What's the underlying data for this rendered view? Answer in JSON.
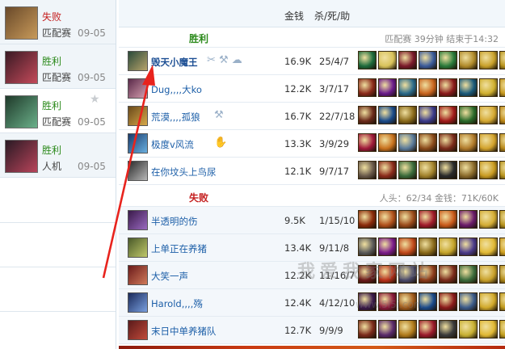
{
  "left_matches": [
    {
      "result": "失败",
      "type": "lose",
      "mode": "匹配赛",
      "date": "09-05",
      "portrait": [
        "#6a4a2a",
        "#c89a5a"
      ]
    },
    {
      "result": "胜利",
      "type": "win",
      "mode": "匹配赛",
      "date": "09-05",
      "portrait": [
        "#3a1a24",
        "#c44a5a"
      ]
    },
    {
      "result": "胜利",
      "type": "win",
      "mode": "匹配赛",
      "date": "09-05",
      "portrait": [
        "#1f3a2a",
        "#6bb08a"
      ],
      "starred": true,
      "active": true
    },
    {
      "result": "胜利",
      "type": "win",
      "mode": "人机",
      "date": "09-05",
      "portrait": [
        "#2a1a24",
        "#b8445a"
      ]
    }
  ],
  "header": {
    "gold_label": "金钱",
    "kda_label": "杀/死/助"
  },
  "team_win": {
    "title": "胜利",
    "meta": "匹配赛 39分钟 结束于14:32",
    "players": [
      {
        "name": "毁天小魔王",
        "me": true,
        "tags": "✂ ⚒ ☁",
        "gold": "16.9K",
        "kda": "25/4/7",
        "champ": [
          "#2a4a3a",
          "#b7a36a"
        ]
      },
      {
        "name": "Dug,,,,大ko",
        "tags": "",
        "gold": "12.2K",
        "kda": "3/7/17",
        "champ": [
          "#5a2a4a",
          "#d7a0b0"
        ]
      },
      {
        "name": "荒漠,,,,孤狼",
        "tags": "⚒",
        "gold": "16.7K",
        "kda": "22/7/18",
        "champ": [
          "#6a4a1a",
          "#d6a84a"
        ]
      },
      {
        "name": "极度v风流",
        "tags": "✋",
        "gold": "13.3K",
        "kda": "3/9/29",
        "champ": [
          "#1a3a6a",
          "#6ab0e0"
        ]
      },
      {
        "name": "在你坟头上鸟尿",
        "tags": "",
        "gold": "12.1K",
        "kda": "9/7/17",
        "champ": [
          "#2a2a2a",
          "#b8b8b8"
        ]
      }
    ]
  },
  "team_lose": {
    "title": "失败",
    "meta": "人头：62/34 金钱：71K/60K",
    "players": [
      {
        "name": "半透明的伤",
        "gold": "9.5K",
        "kda": "1/15/10",
        "champ": [
          "#3a1a4a",
          "#9a6ac0"
        ]
      },
      {
        "name": "上单正在养猪",
        "gold": "13.4K",
        "kda": "9/11/8",
        "champ": [
          "#4a5a2a",
          "#c0c86a"
        ]
      },
      {
        "name": "大笑一声",
        "gold": "12.2K",
        "kda": "11/16/7",
        "champ": [
          "#6a1a1a",
          "#d07a5a"
        ]
      },
      {
        "name": "Harold,,,,殇",
        "gold": "12.4K",
        "kda": "4/12/10",
        "champ": [
          "#1a2a5a",
          "#7aa0e0"
        ]
      },
      {
        "name": "末日中单养猪队",
        "gold": "12.7K",
        "kda": "9/9/9",
        "champ": [
          "#5a1a1a",
          "#c04a3a"
        ]
      }
    ]
  },
  "item_colors": [
    [
      "#1e6b3c",
      "#d8c25a",
      "#7a1a2a",
      "#3a5a9a",
      "#2a7a3a",
      "#b08a2a",
      "#c8a02a",
      "#b8941e"
    ],
    [
      "#8a2a1a",
      "#6a1a8a",
      "#2a6a8a",
      "#c8641e",
      "#8a1a1a",
      "#1a5a7a",
      "#d0b030",
      "#c89a20"
    ],
    [
      "#6a2a1a",
      "#1a4a8a",
      "#8a6a1a",
      "#3a3a8a",
      "#a01a1a",
      "#2a6a2a",
      "#d4a832",
      "#c08a18"
    ],
    [
      "#a01a3a",
      "#c8721e",
      "#5a7a9a",
      "#8a4a1a",
      "#7a2a1a",
      "#b07a2a",
      "#d2a22c",
      "#b88a1c"
    ],
    [
      "#6a5a4a",
      "#8a2a1a",
      "#3a6a3a",
      "#a0802a",
      "#2a2a2a",
      "#8a6a2a",
      "#c89a20",
      "#b8941e"
    ],
    [
      "#8a2a0a",
      "#b0501a",
      "#9a4a1a",
      "#a01a2a",
      "#c85a1a",
      "#6a1a6a",
      "#d4ac34",
      "#b8941e"
    ],
    [
      "#5a5a5a",
      "#7a1a8a",
      "#c0481a",
      "#8a6a1a",
      "#c4a42a",
      "#4a3a8a",
      "#e0b834",
      "#d0a020"
    ],
    [
      "#6a1a1a",
      "#b8301a",
      "#4a4a6a",
      "#8a3a1a",
      "#7a2a1a",
      "#3a6a3a",
      "#c8a02a",
      "#b08a1a"
    ],
    [
      "#3a1a4a",
      "#8a1a3a",
      "#a05a1a",
      "#1a4a8a",
      "#8a1a1a",
      "#3a5a8a",
      "#d0a82a",
      "#c09a1e"
    ],
    [
      "#7a2a1a",
      "#5a2a6a",
      "#b07a1a",
      "#9a1a2a",
      "#3a3a3a",
      "#c8b032",
      "#e0b834",
      "#c4a020"
    ]
  ],
  "watermark": {
    "line1": "我爱我家网站",
    "line2": "www.5i5j.com"
  }
}
